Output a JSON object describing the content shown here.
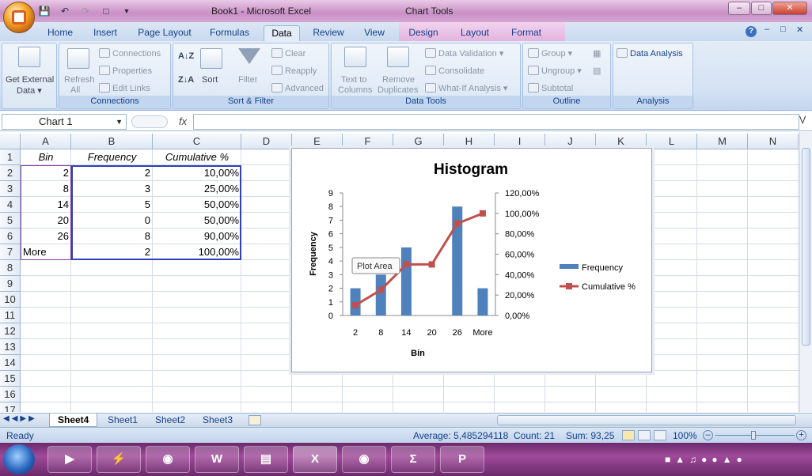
{
  "window": {
    "title": "Book1 - Microsoft Excel",
    "context_tab_group": "Chart Tools"
  },
  "tabs": [
    "Home",
    "Insert",
    "Page Layout",
    "Formulas",
    "Data",
    "Review",
    "View",
    "Design",
    "Layout",
    "Format"
  ],
  "active_tab": "Data",
  "ribbon": {
    "get_external_data": {
      "label1": "Get External",
      "label2": "Data"
    },
    "connections": {
      "refresh1": "Refresh",
      "refresh2": "All",
      "connections": "Connections",
      "properties": "Properties",
      "edit_links": "Edit Links",
      "group": "Connections"
    },
    "sort_filter": {
      "sort": "Sort",
      "filter": "Filter",
      "clear": "Clear",
      "reapply": "Reapply",
      "advanced": "Advanced",
      "group": "Sort & Filter"
    },
    "data_tools": {
      "text_to_columns1": "Text to",
      "text_to_columns2": "Columns",
      "remove_dup1": "Remove",
      "remove_dup2": "Duplicates",
      "data_validation": "Data Validation",
      "consolidate": "Consolidate",
      "what_if": "What-If Analysis",
      "group": "Data Tools"
    },
    "outline": {
      "group_btn": "Group",
      "ungroup": "Ungroup",
      "subtotal": "Subtotal",
      "group": "Outline"
    },
    "analysis": {
      "data_analysis": "Data Analysis",
      "group": "Analysis"
    }
  },
  "formula_bar": {
    "name_box": "Chart 1",
    "fx": "fx",
    "formula": ""
  },
  "columns": [
    "A",
    "B",
    "C",
    "D",
    "E",
    "F",
    "G",
    "H",
    "I",
    "J",
    "K",
    "L",
    "M",
    "N"
  ],
  "rows": [
    "1",
    "2",
    "3",
    "4",
    "5",
    "6",
    "7",
    "8",
    "9",
    "10",
    "11",
    "12",
    "13",
    "14",
    "15",
    "16",
    "17"
  ],
  "table": {
    "headers": [
      "Bin",
      "Frequency",
      "Cumulative %"
    ],
    "rows": [
      [
        "2",
        "2",
        "10,00%"
      ],
      [
        "8",
        "3",
        "25,00%"
      ],
      [
        "14",
        "5",
        "50,00%"
      ],
      [
        "20",
        "0",
        "50,00%"
      ],
      [
        "26",
        "8",
        "90,00%"
      ],
      [
        "More",
        "2",
        "100,00%"
      ]
    ]
  },
  "chart_data": {
    "type": "bar",
    "title": "Histogram",
    "xlabel": "Bin",
    "ylabel": "Frequency",
    "categories": [
      "2",
      "8",
      "14",
      "20",
      "26",
      "More"
    ],
    "series": [
      {
        "name": "Frequency",
        "type": "bar",
        "axis": "left",
        "values": [
          2,
          3,
          5,
          0,
          8,
          2
        ]
      },
      {
        "name": "Cumulative %",
        "type": "line",
        "axis": "right",
        "values": [
          10,
          25,
          50,
          50,
          90,
          100
        ]
      }
    ],
    "ylim": [
      0,
      9
    ],
    "yticks": [
      "0",
      "1",
      "2",
      "3",
      "4",
      "5",
      "6",
      "7",
      "8",
      "9"
    ],
    "y2lim": [
      0,
      120
    ],
    "y2ticks": [
      "0,00%",
      "20,00%",
      "40,00%",
      "60,00%",
      "80,00%",
      "100,00%",
      "120,00%"
    ],
    "legend_position": "right",
    "colors": {
      "bar": "#4f81bd",
      "line": "#c0504d"
    },
    "tooltip": "Plot Area"
  },
  "sheets": [
    "Sheet4",
    "Sheet1",
    "Sheet2",
    "Sheet3"
  ],
  "active_sheet": "Sheet4",
  "status": {
    "ready": "Ready",
    "average": "Average: 5,485294118",
    "count": "Count: 21",
    "sum": "Sum: 93,25",
    "zoom": "100%"
  },
  "taskbar": {
    "apps": [
      "media-player",
      "winamp",
      "firefox",
      "word",
      "explorer",
      "excel",
      "firefox",
      "calculator",
      "powerpoint"
    ]
  }
}
